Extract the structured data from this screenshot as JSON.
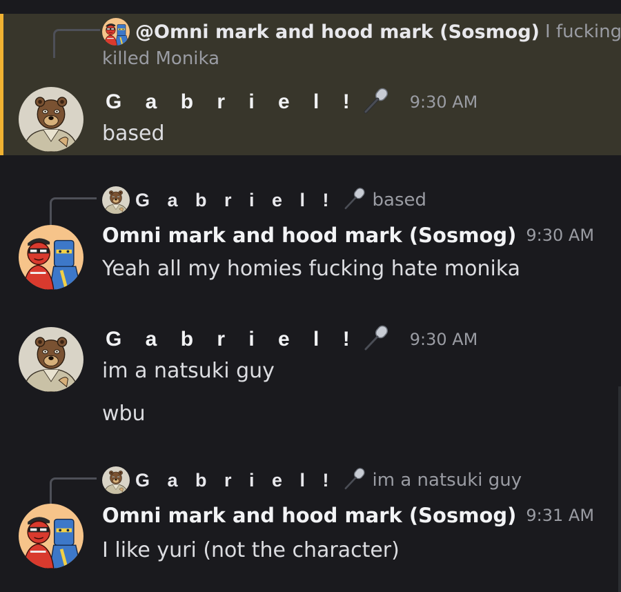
{
  "messages": [
    {
      "highlighted": true,
      "reply": {
        "author": "@Omni mark and hood mark (Sosmog)",
        "text_line1": "I fucking",
        "text_line2": "killed Monika",
        "avatar": "omni-avatar"
      },
      "author": "G a b r i e l !",
      "author_icon": "microphone-icon",
      "time": "9:30 AM",
      "lines": [
        "based"
      ]
    },
    {
      "reply": {
        "author": "G a b r i e l !",
        "author_icon": "microphone-icon",
        "text": "based",
        "avatar": "gabriel-avatar"
      },
      "author": "Omni mark and hood mark (Sosmog)",
      "time": "9:30 AM",
      "lines": [
        "Yeah all my homies fucking hate monika"
      ]
    },
    {
      "author": "G a b r i e l !",
      "author_icon": "microphone-icon",
      "time": "9:30 AM",
      "lines": [
        "im a natsuki guy",
        "wbu"
      ]
    },
    {
      "reply": {
        "author": "G a b r i e l !",
        "author_icon": "microphone-icon",
        "text": "im a natsuki guy",
        "avatar": "gabriel-avatar"
      },
      "author": "Omni mark and hood mark (Sosmog)",
      "time": "9:31 AM",
      "lines": [
        "I like yuri (not the character)"
      ]
    }
  ],
  "colors": {
    "background": "#1a1a1e",
    "highlight_bg": "#38362b",
    "highlight_border": "#f0b232",
    "username": "#f2f3f5",
    "message_text": "#dcdde1",
    "muted_text": "#9a9ca3"
  }
}
